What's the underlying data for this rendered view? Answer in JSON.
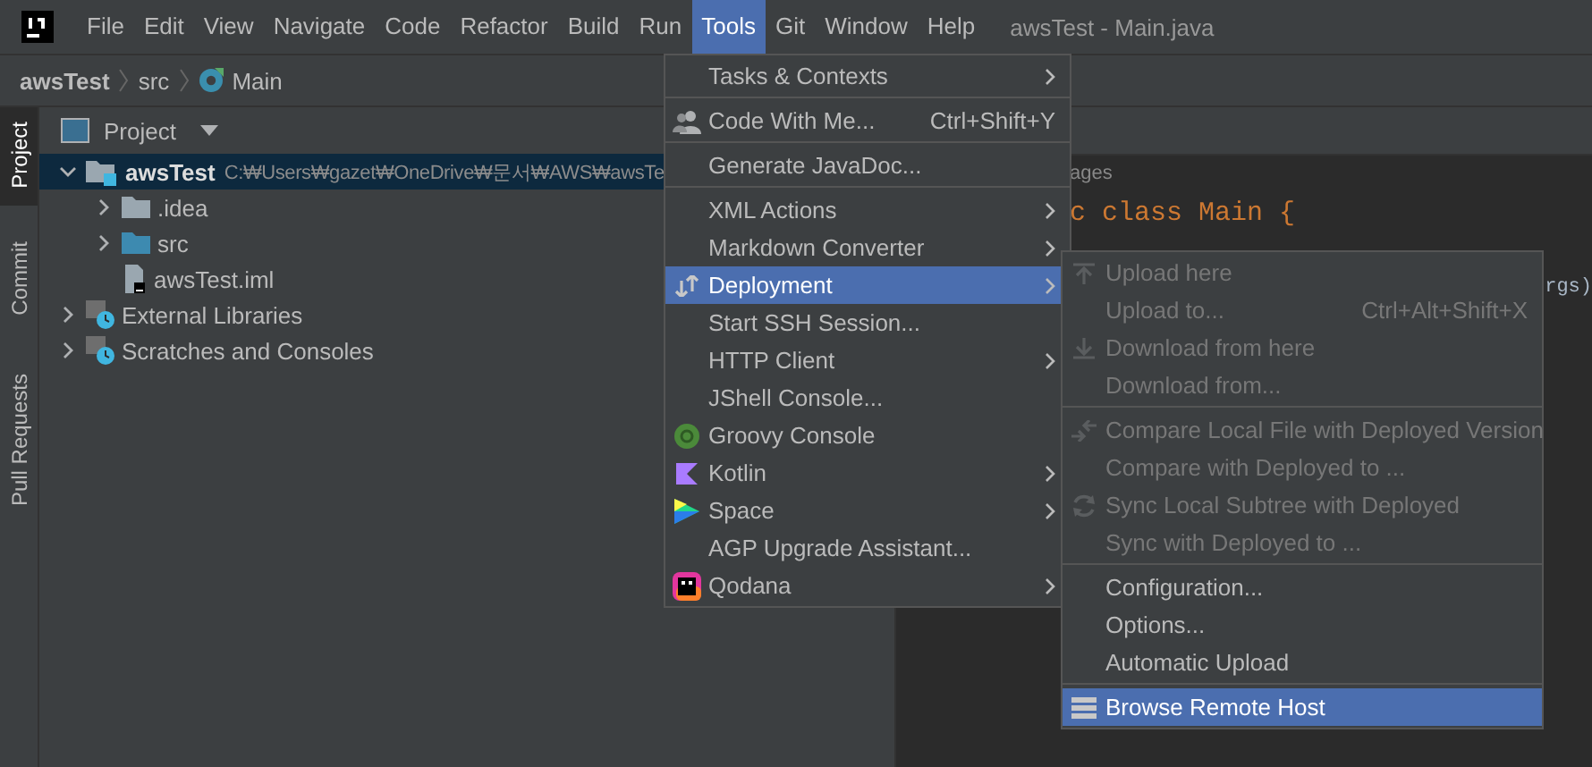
{
  "menubar": {
    "items": [
      {
        "label": "File",
        "selected": false
      },
      {
        "label": "Edit",
        "selected": false
      },
      {
        "label": "View",
        "selected": false
      },
      {
        "label": "Navigate",
        "selected": false
      },
      {
        "label": "Code",
        "selected": false
      },
      {
        "label": "Refactor",
        "selected": false
      },
      {
        "label": "Build",
        "selected": false
      },
      {
        "label": "Run",
        "selected": false
      },
      {
        "label": "Tools",
        "selected": true
      },
      {
        "label": "Git",
        "selected": false
      },
      {
        "label": "Window",
        "selected": false
      },
      {
        "label": "Help",
        "selected": false
      }
    ],
    "title": "awsTest - Main.java"
  },
  "breadcrumbs": [
    "awsTest",
    "src",
    "Main"
  ],
  "tool_strip": [
    {
      "label": "Project",
      "selected": true
    },
    {
      "label": "Commit",
      "selected": false
    },
    {
      "label": "Pull Requests",
      "selected": false
    }
  ],
  "project_panel": {
    "title": "Project",
    "tree": [
      {
        "label": "awsTest",
        "path": "C:₩Users₩gazet₩OneDrive₩문서₩AWS₩awsTe",
        "expanded": true,
        "selected": true,
        "children": [
          {
            "label": ".idea",
            "expanded": false,
            "selected": false
          },
          {
            "label": "src",
            "expanded": false,
            "selected": false
          },
          {
            "label": "awsTest.iml",
            "selected": false
          }
        ]
      },
      {
        "label": "External Libraries",
        "expanded": false,
        "selected": false
      },
      {
        "label": "Scratches and Consoles",
        "expanded": false,
        "selected": false
      }
    ]
  },
  "editor": {
    "lines": [
      {
        "kind": "hint",
        "text": "ages"
      },
      {
        "kind": "code",
        "text": "c class Main {"
      },
      {
        "kind": "blank"
      },
      {
        "kind": "code_end",
        "text": "rgs)"
      }
    ]
  },
  "tools_menu": {
    "groups": [
      [
        {
          "label": "Tasks & Contexts",
          "submenu": true,
          "selected": false,
          "disabled": false
        }
      ],
      [
        {
          "label": "Code With Me...",
          "shortcut": "Ctrl+Shift+Y",
          "submenu": false,
          "selected": false,
          "disabled": false
        }
      ],
      [
        {
          "label": "Generate JavaDoc...",
          "submenu": false,
          "selected": false,
          "disabled": false
        }
      ],
      [
        {
          "label": "XML Actions",
          "submenu": true,
          "selected": false,
          "disabled": false
        },
        {
          "label": "Markdown Converter",
          "submenu": true,
          "selected": false,
          "disabled": false
        },
        {
          "label": "Deployment",
          "submenu": true,
          "selected": true,
          "disabled": false
        },
        {
          "label": "Start SSH Session...",
          "submenu": false,
          "selected": false,
          "disabled": false
        },
        {
          "label": "HTTP Client",
          "submenu": true,
          "selected": false,
          "disabled": false
        },
        {
          "label": "JShell Console...",
          "submenu": false,
          "selected": false,
          "disabled": false
        },
        {
          "label": "Groovy Console",
          "submenu": false,
          "selected": false,
          "disabled": false
        },
        {
          "label": "Kotlin",
          "submenu": true,
          "selected": false,
          "disabled": false
        },
        {
          "label": "Space",
          "submenu": true,
          "selected": false,
          "disabled": false
        },
        {
          "label": "AGP Upgrade Assistant...",
          "submenu": false,
          "selected": false,
          "disabled": false
        },
        {
          "label": "Qodana",
          "submenu": true,
          "selected": false,
          "disabled": false
        }
      ]
    ]
  },
  "deployment_menu": {
    "groups": [
      [
        {
          "label": "Upload here",
          "submenu": false,
          "selected": false,
          "disabled": true
        },
        {
          "label": "Upload to...",
          "shortcut": "Ctrl+Alt+Shift+X",
          "submenu": false,
          "selected": false,
          "disabled": true
        },
        {
          "label": "Download from here",
          "submenu": false,
          "selected": false,
          "disabled": true
        },
        {
          "label": "Download from...",
          "submenu": false,
          "selected": false,
          "disabled": true
        }
      ],
      [
        {
          "label": "Compare Local File with Deployed Version",
          "submenu": false,
          "selected": false,
          "disabled": true
        },
        {
          "label": "Compare with Deployed to ...",
          "submenu": false,
          "selected": false,
          "disabled": true
        },
        {
          "label": "Sync Local Subtree with Deployed",
          "submenu": false,
          "selected": false,
          "disabled": true
        },
        {
          "label": "Sync with Deployed to ...",
          "submenu": false,
          "selected": false,
          "disabled": true
        }
      ],
      [
        {
          "label": "Configuration...",
          "submenu": false,
          "selected": false,
          "disabled": false
        },
        {
          "label": "Options...",
          "submenu": false,
          "selected": false,
          "disabled": false
        },
        {
          "label": "Automatic Upload",
          "submenu": false,
          "selected": false,
          "disabled": false
        }
      ],
      [
        {
          "label": "Browse Remote Host",
          "submenu": false,
          "selected": true,
          "disabled": false
        }
      ]
    ]
  }
}
